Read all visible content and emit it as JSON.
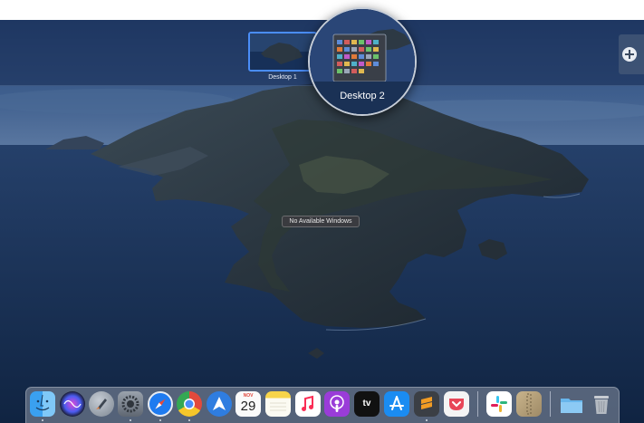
{
  "spaces": {
    "desktops": [
      {
        "label": "Desktop 1",
        "selected": true
      }
    ],
    "magnified_label": "Desktop 2",
    "add_space_icon": "plus-icon"
  },
  "overlay": {
    "no_windows_text": "No Available Windows"
  },
  "dock": {
    "apps": [
      {
        "name": "finder-icon",
        "running": true
      },
      {
        "name": "siri-icon",
        "running": false
      },
      {
        "name": "launchpad-icon",
        "running": false
      },
      {
        "name": "system-preferences-icon",
        "running": true
      },
      {
        "name": "safari-icon",
        "running": true
      },
      {
        "name": "chrome-icon",
        "running": true
      },
      {
        "name": "airmail-icon",
        "running": false
      },
      {
        "name": "calendar-icon",
        "running": false
      },
      {
        "name": "notes-icon",
        "running": false
      },
      {
        "name": "music-icon",
        "running": false
      },
      {
        "name": "podcasts-icon",
        "running": false
      },
      {
        "name": "apple-tv-icon",
        "running": false
      },
      {
        "name": "app-store-icon",
        "running": false
      },
      {
        "name": "sublime-text-icon",
        "running": false
      },
      {
        "name": "pocket-icon",
        "running": false
      },
      {
        "name": "slack-icon",
        "running": false
      },
      {
        "name": "archive-utility-icon",
        "running": false
      },
      {
        "name": "downloads-folder-icon",
        "running": false
      },
      {
        "name": "trash-icon",
        "running": false
      }
    ],
    "calendar_month": "NOV",
    "calendar_day": "29",
    "tv_label": "tv"
  },
  "colors": {
    "selection_border": "#4a8df8",
    "safari": "#1f7bf0",
    "app_store": "#1a8cf2",
    "podcasts": "#9a3cd8",
    "music": "#fa2d55",
    "sublime": "#f29c24"
  }
}
